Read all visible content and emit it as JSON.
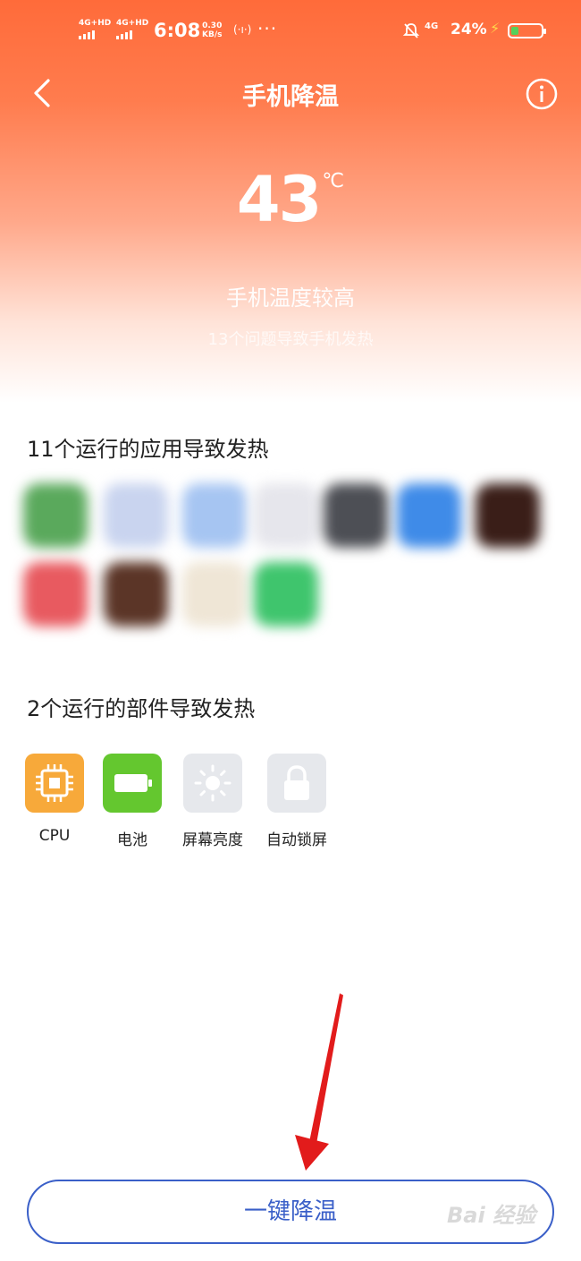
{
  "status_bar": {
    "sim1": "4G+HD",
    "sim2": "4G+HD",
    "time": "6:08",
    "speed_value": "0.30",
    "speed_unit": "KB/s",
    "network": "4G",
    "battery": "24%",
    "battery_level": 0.24
  },
  "header": {
    "title": "手机降温"
  },
  "temperature": {
    "value": "43",
    "unit": "℃"
  },
  "status_text": "手机温度较高",
  "sub_text": "13个问题导致手机发热",
  "apps_section": {
    "title": "11个运行的应用导致发热",
    "app_colors": [
      "#5aa95c",
      "#c9d4ef",
      "#a6c5f2",
      "#e6e6ec",
      "#4d4f55",
      "#3f8be8",
      "#3a1e18",
      "#e85a60",
      "#5b3527",
      "#efe6d6",
      "#3fc56d"
    ]
  },
  "components_section": {
    "title": "2个运行的部件导致发热",
    "items": [
      {
        "label": "CPU",
        "icon": "cpu-icon",
        "color": "#f7a93a"
      },
      {
        "label": "电池",
        "icon": "battery-icon",
        "color": "#64c72f"
      },
      {
        "label": "屏幕亮度",
        "icon": "brightness-icon",
        "color": "#e6e8ec"
      },
      {
        "label": "自动锁屏",
        "icon": "lock-icon",
        "color": "#e6e8ec"
      }
    ]
  },
  "action_button": {
    "label": "一键降温"
  },
  "watermark": "Bai 经验"
}
